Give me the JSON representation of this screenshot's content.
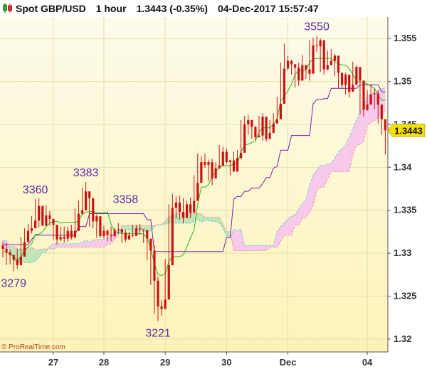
{
  "header": {
    "instrument": "Spot GBP/USD",
    "timeframe": "1 hour",
    "price_change": "1.3443 (-0.35%)",
    "datetime": "04-Dec-2017 15:57:47"
  },
  "watermark": "© ProRealTime.com",
  "current_price_label": "1.3443",
  "colors": {
    "background_top": "#fdfbea",
    "background_bottom": "#fdf3b8",
    "bull_candle": "#cc1111",
    "bear_candle": "#cc1111",
    "cloud_fill": "#f8c9ea",
    "cloud_fill_green": "#bfe6b4",
    "kijun": "#7a1fb0",
    "tenkan": "#1bbb1b",
    "senkou_b_dashed": "#f08ab4",
    "senkou_a_dashed": "#5ecbe0",
    "label_text": "#5b2aa0",
    "price_tag": "#f7e000"
  },
  "chart_data": {
    "type": "candlestick",
    "title": "Spot GBP/USD",
    "ylim": [
      1.3185,
      1.3575
    ],
    "y_ticks": [
      "1.355",
      "1.35",
      "1.345",
      "1.34",
      "1.335",
      "1.33",
      "1.325",
      "1.32"
    ],
    "y_tick_values": [
      1.355,
      1.35,
      1.345,
      1.34,
      1.335,
      1.33,
      1.325,
      1.32
    ],
    "x_ticks": [
      "27",
      "28",
      "29",
      "30",
      "Dec",
      "04"
    ],
    "x_tick_index": [
      14,
      28,
      45,
      62,
      79,
      101
    ],
    "n_bars": 107,
    "close": [
      1.3305,
      1.3301,
      1.3298,
      1.3292,
      1.3286,
      1.3296,
      1.3313,
      1.3326,
      1.3329,
      1.3338,
      1.3355,
      1.3332,
      1.3344,
      1.334,
      1.3333,
      1.3316,
      1.3319,
      1.3317,
      1.3326,
      1.3318,
      1.3326,
      1.3346,
      1.335,
      1.3372,
      1.3364,
      1.3337,
      1.3343,
      1.332,
      1.3326,
      1.3321,
      1.332,
      1.3327,
      1.3328,
      1.3324,
      1.3316,
      1.3321,
      1.332,
      1.3329,
      1.3328,
      1.3327,
      1.3317,
      1.3303,
      1.3268,
      1.3238,
      1.3235,
      1.3246,
      1.3286,
      1.3353,
      1.3359,
      1.3348,
      1.3341,
      1.3357,
      1.3347,
      1.3361,
      1.3382,
      1.3406,
      1.3403,
      1.3406,
      1.3387,
      1.3399,
      1.3402,
      1.3418,
      1.3406,
      1.3408,
      1.3395,
      1.3411,
      1.3417,
      1.345,
      1.3455,
      1.3447,
      1.3435,
      1.3437,
      1.3459,
      1.3433,
      1.344,
      1.3451,
      1.3456,
      1.3474,
      1.3515,
      1.3524,
      1.352,
      1.3516,
      1.3501,
      1.3519,
      1.3514,
      1.3509,
      1.3542,
      1.3541,
      1.3548,
      1.3514,
      1.3519,
      1.3524,
      1.353,
      1.351,
      1.3496,
      1.3508,
      1.3488,
      1.3496,
      1.3517,
      1.3501,
      1.3467,
      1.3473,
      1.3485,
      1.3486,
      1.3473,
      1.3456,
      1.3443
    ],
    "high": [
      1.3314,
      1.3312,
      1.3304,
      1.3297,
      1.3305,
      1.3319,
      1.3329,
      1.3334,
      1.3343,
      1.3363,
      1.3364,
      1.3351,
      1.3356,
      1.3349,
      1.3338,
      1.3332,
      1.3331,
      1.3331,
      1.3331,
      1.3333,
      1.3352,
      1.3361,
      1.3376,
      1.3383,
      1.3367,
      1.336,
      1.3345,
      1.3336,
      1.3332,
      1.3328,
      1.3331,
      1.333,
      1.3335,
      1.3327,
      1.3327,
      1.3325,
      1.3333,
      1.3333,
      1.3334,
      1.3328,
      1.3324,
      1.3317,
      1.3309,
      1.3273,
      1.3245,
      1.3293,
      1.3357,
      1.3369,
      1.3366,
      1.3367,
      1.3364,
      1.3361,
      1.3365,
      1.3391,
      1.3416,
      1.3413,
      1.3416,
      1.3409,
      1.341,
      1.3406,
      1.3426,
      1.3424,
      1.3422,
      1.3409,
      1.3418,
      1.342,
      1.3455,
      1.346,
      1.3461,
      1.345,
      1.3448,
      1.346,
      1.3463,
      1.3449,
      1.3455,
      1.3463,
      1.3482,
      1.3522,
      1.3544,
      1.353,
      1.3525,
      1.3516,
      1.3522,
      1.3531,
      1.3518,
      1.3548,
      1.3551,
      1.3553,
      1.355,
      1.352,
      1.3536,
      1.3538,
      1.3532,
      1.3516,
      1.351,
      1.351,
      1.3506,
      1.3523,
      1.3519,
      1.3504,
      1.3476,
      1.349,
      1.3497,
      1.3492,
      1.349,
      1.3461,
      1.3455
    ],
    "low": [
      1.3295,
      1.3286,
      1.3287,
      1.3279,
      1.3282,
      1.3289,
      1.3308,
      1.3314,
      1.3323,
      1.3337,
      1.333,
      1.3332,
      1.3341,
      1.3332,
      1.3315,
      1.331,
      1.3314,
      1.3312,
      1.3313,
      1.3316,
      1.3324,
      1.3342,
      1.3345,
      1.3362,
      1.3331,
      1.3329,
      1.3318,
      1.3318,
      1.3317,
      1.3314,
      1.3314,
      1.3318,
      1.3322,
      1.3312,
      1.3313,
      1.3317,
      1.3319,
      1.3326,
      1.3321,
      1.3312,
      1.3292,
      1.3263,
      1.3229,
      1.3221,
      1.3227,
      1.324,
      1.3285,
      1.3344,
      1.334,
      1.3339,
      1.3335,
      1.3342,
      1.3341,
      1.3357,
      1.3373,
      1.3396,
      1.3399,
      1.3384,
      1.3379,
      1.3394,
      1.3398,
      1.3401,
      1.3404,
      1.3391,
      1.3395,
      1.3405,
      1.3409,
      1.3443,
      1.3438,
      1.3433,
      1.3431,
      1.3435,
      1.3431,
      1.343,
      1.3436,
      1.3446,
      1.3452,
      1.347,
      1.3511,
      1.3513,
      1.3508,
      1.3493,
      1.3495,
      1.3508,
      1.3503,
      1.3501,
      1.3538,
      1.3534,
      1.3511,
      1.3508,
      1.3513,
      1.3519,
      1.3506,
      1.3492,
      1.3491,
      1.3485,
      1.3481,
      1.3492,
      1.3497,
      1.3462,
      1.3459,
      1.3466,
      1.3474,
      1.3468,
      1.3451,
      1.3438,
      1.3415
    ],
    "tenkan": [
      1.3302,
      1.3301,
      1.3299,
      1.3296,
      1.3292,
      1.3295,
      1.3304,
      1.3307,
      1.3311,
      1.3322,
      1.3322,
      1.3325,
      1.3331,
      1.3335,
      1.3337,
      1.3337,
      1.3335,
      1.3336,
      1.3336,
      1.3336,
      1.3336,
      1.3337,
      1.3345,
      1.3348,
      1.3348,
      1.3349,
      1.3347,
      1.3347,
      1.3347,
      1.3348,
      1.3334,
      1.3325,
      1.3324,
      1.3323,
      1.3323,
      1.3323,
      1.3323,
      1.3323,
      1.3323,
      1.3322,
      1.3318,
      1.3305,
      1.3288,
      1.3275,
      1.3274,
      1.3276,
      1.329,
      1.3296,
      1.3296,
      1.3296,
      1.3298,
      1.3307,
      1.3318,
      1.3327,
      1.3357,
      1.3377,
      1.3377,
      1.338,
      1.3389,
      1.3395,
      1.34,
      1.3402,
      1.3402,
      1.3402,
      1.3404,
      1.3404,
      1.3418,
      1.3426,
      1.3427,
      1.3429,
      1.3431,
      1.3441,
      1.3446,
      1.3446,
      1.3446,
      1.345,
      1.3457,
      1.3477,
      1.3483,
      1.3489,
      1.3497,
      1.3508,
      1.3513,
      1.3513,
      1.3513,
      1.3522,
      1.3526,
      1.3527,
      1.3527,
      1.3527,
      1.3527,
      1.3527,
      1.3523,
      1.3521,
      1.3519,
      1.3519,
      1.3515,
      1.3508,
      1.3501,
      1.3499,
      1.3499,
      1.3497,
      1.3495,
      1.3492,
      1.3484,
      1.3478,
      1.3478
    ],
    "kijun": [
      1.331,
      1.331,
      1.331,
      1.331,
      1.331,
      1.331,
      1.331,
      1.331,
      1.3316,
      1.3321,
      1.3321,
      1.3321,
      1.3321,
      1.3321,
      1.3321,
      1.3321,
      1.3321,
      1.3321,
      1.3321,
      1.3321,
      1.3321,
      1.3331,
      1.3331,
      1.3331,
      1.3346,
      1.3346,
      1.3346,
      1.3346,
      1.3346,
      1.3346,
      1.3346,
      1.3346,
      1.3346,
      1.3346,
      1.3346,
      1.3346,
      1.3346,
      1.3346,
      1.3346,
      1.3346,
      1.3339,
      1.3339,
      1.3302,
      1.3302,
      1.3302,
      1.3302,
      1.3302,
      1.3302,
      1.3302,
      1.3302,
      1.3302,
      1.3302,
      1.3302,
      1.3302,
      1.3302,
      1.3302,
      1.3302,
      1.3302,
      1.3302,
      1.3302,
      1.3302,
      1.3302,
      1.3318,
      1.3318,
      1.3363,
      1.3366,
      1.3366,
      1.3372,
      1.3372,
      1.3376,
      1.3376,
      1.3376,
      1.3381,
      1.3388,
      1.3388,
      1.3399,
      1.3401,
      1.342,
      1.342,
      1.342,
      1.3437,
      1.3437,
      1.3437,
      1.3437,
      1.3437,
      1.3437,
      1.3474,
      1.3479,
      1.3479,
      1.348,
      1.348,
      1.3492,
      1.3492,
      1.3492,
      1.3492,
      1.3492,
      1.3492,
      1.3492,
      1.3492,
      1.3496,
      1.3496,
      1.3496,
      1.3496,
      1.3496,
      1.3496,
      1.3488,
      1.3488
    ],
    "span_a": [
      1.3315,
      1.3315,
      1.3302,
      1.3293,
      1.3289,
      1.3289,
      1.3289,
      1.3289,
      1.3289,
      1.3291,
      1.3295,
      1.3301,
      1.3301,
      1.3308,
      1.3311,
      1.3311,
      1.3311,
      1.3311,
      1.3311,
      1.3311,
      1.3311,
      1.3311,
      1.3313,
      1.3315,
      1.3313,
      1.3315,
      1.3316,
      1.3316,
      1.3316,
      1.3318,
      1.332,
      1.3324,
      1.3326,
      1.3325,
      1.3327,
      1.3327,
      1.3325,
      1.3326,
      1.3326,
      1.3325,
      1.3325,
      1.3326,
      1.3331,
      1.3333,
      1.3333,
      1.3334,
      1.3335,
      1.3335,
      1.3335,
      1.3335,
      1.3335,
      1.3335,
      1.3335,
      1.3338,
      1.3339,
      1.3336,
      1.3338,
      1.3338,
      1.3337,
      1.3337,
      1.3335,
      1.3329,
      1.332,
      1.3318,
      1.3328,
      1.3326,
      1.3328,
      1.3309,
      1.3309,
      1.3309,
      1.3309,
      1.3309,
      1.3309,
      1.3309,
      1.3309,
      1.3309,
      1.3325,
      1.3331,
      1.3335,
      1.334,
      1.3343,
      1.3345,
      1.3351,
      1.3358,
      1.3362,
      1.3379,
      1.3391,
      1.3397,
      1.3402,
      1.3402,
      1.3404,
      1.3405,
      1.341,
      1.3418,
      1.3422,
      1.3426,
      1.3435,
      1.3445,
      1.3455,
      1.3465,
      1.347,
      1.3485,
      1.3485,
      1.3487,
      1.3489,
      1.3491,
      1.3494
    ],
    "span_b": [
      1.3305,
      1.3305,
      1.3308,
      1.3308,
      1.3305,
      1.3305,
      1.3305,
      1.3305,
      1.3307,
      1.3304,
      1.3304,
      1.3305,
      1.3305,
      1.3305,
      1.3305,
      1.3307,
      1.3307,
      1.3307,
      1.3307,
      1.3307,
      1.3307,
      1.3307,
      1.3307,
      1.3307,
      1.3307,
      1.3307,
      1.3307,
      1.3307,
      1.3307,
      1.331,
      1.3311,
      1.3316,
      1.3323,
      1.3332,
      1.3332,
      1.3332,
      1.3332,
      1.3332,
      1.3332,
      1.3332,
      1.3332,
      1.3332,
      1.3332,
      1.3333,
      1.3333,
      1.3337,
      1.3342,
      1.3345,
      1.3346,
      1.3346,
      1.3346,
      1.3346,
      1.3346,
      1.3346,
      1.3346,
      1.3346,
      1.3342,
      1.3342,
      1.3342,
      1.3342,
      1.3342,
      1.3334,
      1.3325,
      1.3325,
      1.3303,
      1.3303,
      1.3303,
      1.3303,
      1.3303,
      1.3303,
      1.3303,
      1.3303,
      1.3303,
      1.3303,
      1.3307,
      1.3307,
      1.3307,
      1.3314,
      1.3321,
      1.3321,
      1.3321,
      1.3333,
      1.3333,
      1.3341,
      1.3341,
      1.3348,
      1.3356,
      1.3373,
      1.3377,
      1.3377,
      1.3387,
      1.3395,
      1.3395,
      1.3395,
      1.3395,
      1.3395,
      1.3395,
      1.3415,
      1.3425,
      1.3427,
      1.343,
      1.3449,
      1.3452,
      1.3454,
      1.3458,
      1.346,
      1.3466
    ],
    "annotations": [
      {
        "text": "3279",
        "bar": 3,
        "value": 1.3279,
        "pos": "below"
      },
      {
        "text": "3360",
        "bar": 9,
        "value": 1.3363,
        "pos": "above"
      },
      {
        "text": "3383",
        "bar": 23,
        "value": 1.3383,
        "pos": "above"
      },
      {
        "text": "3358",
        "bar": 34,
        "value": 1.3352,
        "pos": "above"
      },
      {
        "text": "3221",
        "bar": 43,
        "value": 1.3221,
        "pos": "below"
      },
      {
        "text": "3550",
        "bar": 87,
        "value": 1.3553,
        "pos": "above"
      }
    ]
  }
}
